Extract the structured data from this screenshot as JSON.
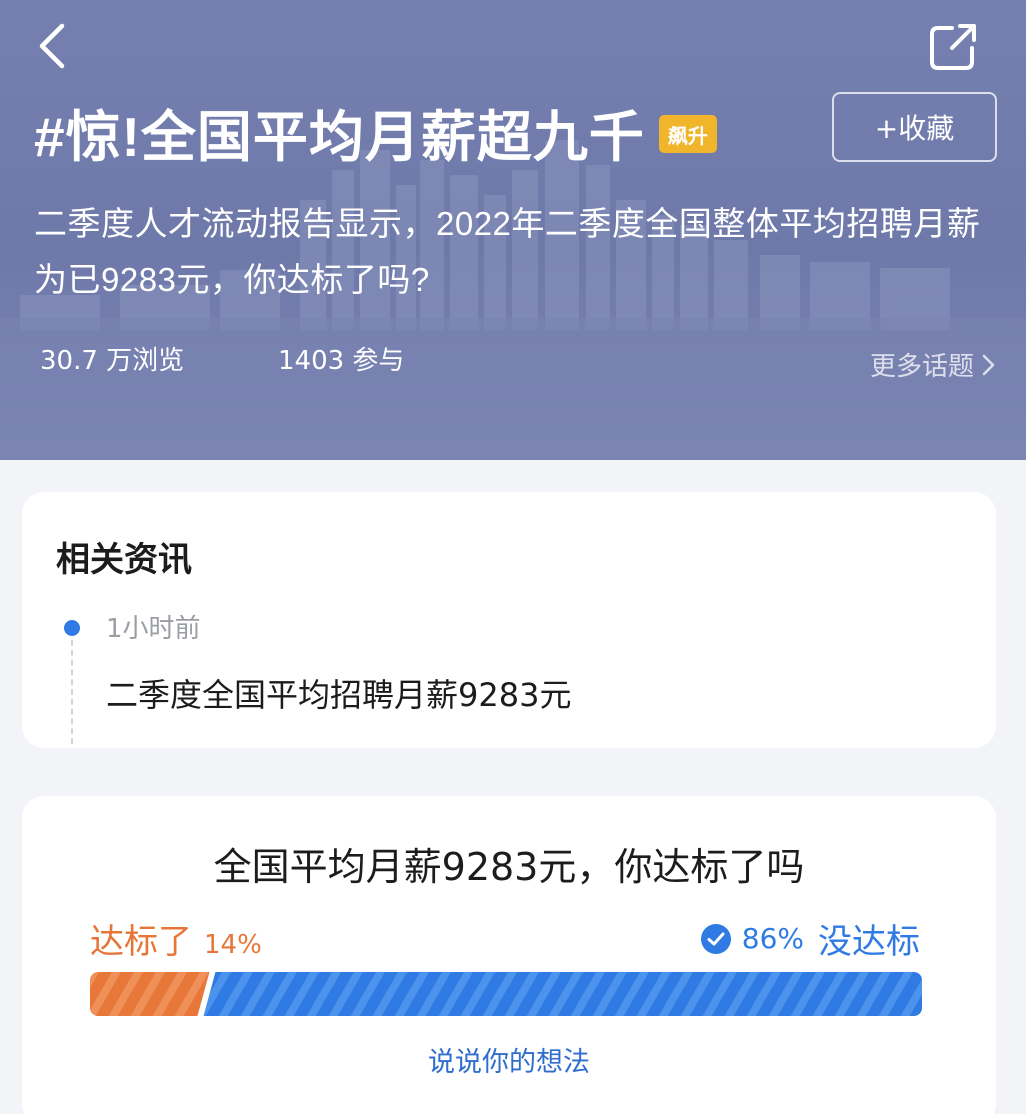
{
  "header": {
    "title": "#惊!全国平均月薪超九千",
    "hot_badge": "飙升",
    "favorite_label": "+收藏",
    "description": "二季度人才流动报告显示，2022年二季度全国整体平均招聘月薪为已9283元，你达标了吗?",
    "views": "30.7 万浏览",
    "participants": "1403 参与",
    "more_topics": "更多话题",
    "icons": {
      "back": "back-arrow-icon",
      "share": "share-icon",
      "more": "chevron-right-icon"
    }
  },
  "related_news": {
    "heading": "相关资讯",
    "items": [
      {
        "time": "1小时前",
        "title": "二季度全国平均招聘月薪9283元"
      }
    ]
  },
  "poll": {
    "question": "全国平均月薪9283元，你达标了吗",
    "option_a": {
      "label": "达标了",
      "percent_text": "14%",
      "percent": 14,
      "color": "#e77538"
    },
    "option_b": {
      "label": "没达标",
      "percent_text": "86%",
      "percent": 86,
      "color": "#2f7be3",
      "selected": true
    },
    "comment_label": "说说你的想法"
  }
}
